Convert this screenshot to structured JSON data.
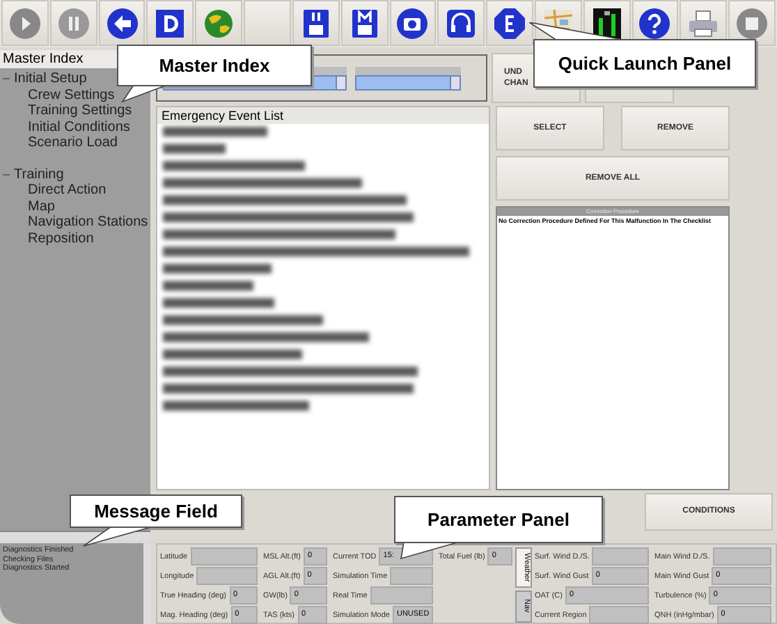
{
  "master_index": {
    "title": "Master Index",
    "groups": [
      {
        "label": "Initial Setup",
        "expanded": true,
        "children": [
          {
            "label": "Crew Settings"
          },
          {
            "label": "Training Settings"
          },
          {
            "label": "Initial Conditions"
          },
          {
            "label": "Scenario Load"
          }
        ]
      },
      {
        "label": "Training",
        "expanded": true,
        "children": [
          {
            "label": "Direct Action"
          },
          {
            "label": "Map"
          },
          {
            "label": "Navigation Stations"
          },
          {
            "label": "Reposition"
          }
        ]
      }
    ]
  },
  "top_buttons": [
    {
      "lines": [
        "UND",
        "CHAN"
      ]
    }
  ],
  "event_list": {
    "title": "Emergency Event List"
  },
  "actions": [
    "SELECT",
    "REMOVE",
    "REMOVE ALL"
  ],
  "correction_procedure": {
    "title": "Correction Procedure",
    "text": "No Correction Procedure Defined For This Malfunction In The Checklist"
  },
  "conditions_button": "CONDITIONS",
  "messages": [
    "Diagnostics Finished",
    "Checking Files",
    "Diagnostics Started"
  ],
  "parameters": [
    [
      {
        "label": "Latitude"
      },
      {
        "label": "Longitude"
      },
      {
        "label": "True Heading (deg)",
        "value": "0"
      },
      {
        "label": "Mag. Heading (deg)",
        "value": "0"
      }
    ],
    [
      {
        "label": "MSL Alt.(ft)",
        "value": "0"
      },
      {
        "label": "AGL Alt.(ft)",
        "value": "0"
      },
      {
        "label": "GW(lb)",
        "value": "0"
      },
      {
        "label": "TAS (kts)",
        "value": "0"
      }
    ],
    [
      {
        "label": "Current TOD",
        "value": "15:"
      },
      {
        "label": "Simulation Time"
      },
      {
        "label": "Real Time"
      },
      {
        "label": "Simulation Mode",
        "value": "UNUSED"
      }
    ],
    [
      {
        "label": "Total Fuel (lb)",
        "value": "0"
      }
    ]
  ],
  "side_tabs": [
    {
      "label": "Weather",
      "selected": true
    },
    {
      "label": "Nav",
      "selected": false
    }
  ],
  "weather": [
    [
      {
        "label": "Surf. Wind D./S."
      },
      {
        "label": "Surf. Wind Gust",
        "value": "0"
      },
      {
        "label": "OAT (C)",
        "value": "0"
      },
      {
        "label": "Current Region"
      }
    ],
    [
      {
        "label": "Main Wind D./S."
      },
      {
        "label": "Main Wind Gust",
        "value": "0"
      },
      {
        "label": "Turbulence (%)",
        "value": "0"
      },
      {
        "label": "QNH (inHg/mbar)",
        "value": "0"
      }
    ]
  ],
  "callouts": [
    "Master Index",
    "Quick Launch Panel",
    "Message Field",
    "Parameter Panel"
  ]
}
